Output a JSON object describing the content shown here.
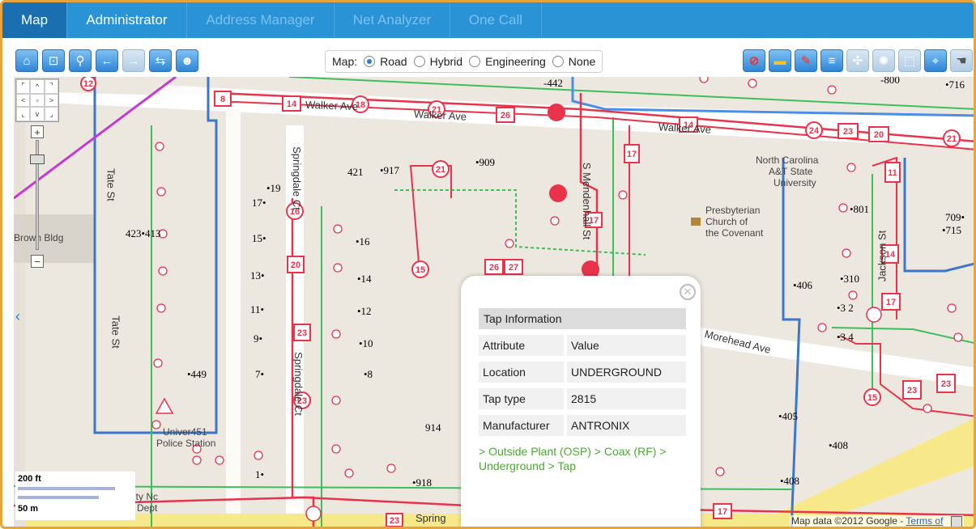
{
  "tabs": [
    {
      "label": "Map",
      "active": true
    },
    {
      "label": "Administrator",
      "active": false
    },
    {
      "label": "Address Manager",
      "active": false
    },
    {
      "label": "Net Analyzer",
      "active": false
    },
    {
      "label": "One Call",
      "active": false
    }
  ],
  "toolbar": {
    "left_icons": [
      "home-icon",
      "zoom-extent-icon",
      "zoom-icon",
      "back-arrow-icon",
      "forward-arrow-icon",
      "signpost-icon",
      "person-icon"
    ],
    "right_icons": [
      "no-entry-icon",
      "ruler-icon",
      "draw-icon",
      "layers-icon",
      "fullscreen-icon",
      "gear-icon",
      "select-box-icon",
      "crosshair-icon",
      "hand-icon"
    ],
    "map_type_label": "Map:",
    "map_types": [
      {
        "label": "Road",
        "selected": true
      },
      {
        "label": "Hybrid",
        "selected": false
      },
      {
        "label": "Engineering",
        "selected": false
      },
      {
        "label": "None",
        "selected": false
      }
    ]
  },
  "map": {
    "streets": [
      "Walker Ave",
      "Walker Ave",
      "Walker Ave",
      "Tate St",
      "Tate St",
      "Springdale Ct",
      "Springdale Ct",
      "S Mendenhall St",
      "Morehead Ave",
      "Jackson St",
      "Spring"
    ],
    "places": [
      "Brown Bldg",
      "Presbyterian",
      "Church of",
      "the Covenant",
      "North Carolina",
      "A&T State",
      "University",
      "Univer451",
      "Police Station",
      "ity Nc",
      "Dept"
    ],
    "address_numbers": [
      "421",
      "•917",
      "•909",
      "17•",
      "•19",
      "15•",
      "•16",
      "423•413",
      "13•",
      "•14",
      "11•",
      "•12",
      "9•",
      "•10",
      "•449",
      "7•",
      "•8",
      "914",
      "•918",
      "1•",
      "•801",
      "709•",
      "•715",
      "•310",
      "•3 2",
      "•3 4",
      "•406",
      "•405",
      "•408",
      "•408",
      "-442",
      "•716",
      "-800"
    ],
    "cable_labels": [
      "8",
      "14",
      "18",
      "21",
      "26",
      "14",
      "24",
      "23",
      "20",
      "21",
      "17",
      "21",
      "16",
      "20",
      "23",
      "23",
      "15",
      "26",
      "27",
      "17",
      "11",
      "14",
      "17",
      "15",
      "23",
      "23",
      "17",
      "12"
    ],
    "scale": {
      "imperial": "200 ft",
      "metric": "50 m"
    },
    "copyright": "Map data ©2012 Google -",
    "terms_link": "Terms of",
    "colors": {
      "coax": "#e8334a",
      "fiber_green": "#3cbf5a",
      "blue_cable": "#4a8ee8",
      "boundary_orange": "#f0b060",
      "magenta": "#c43bd1"
    }
  },
  "popup": {
    "title": "Tap Information",
    "columns": [
      "Attribute",
      "Value"
    ],
    "rows": [
      {
        "attribute": "Location",
        "value": "UNDERGROUND"
      },
      {
        "attribute": "Tap type",
        "value": "2815"
      },
      {
        "attribute": "Manufacturer",
        "value": "ANTRONIX"
      }
    ],
    "breadcrumb": "> Outside Plant (OSP) > Coax (RF) > Underground > Tap"
  }
}
